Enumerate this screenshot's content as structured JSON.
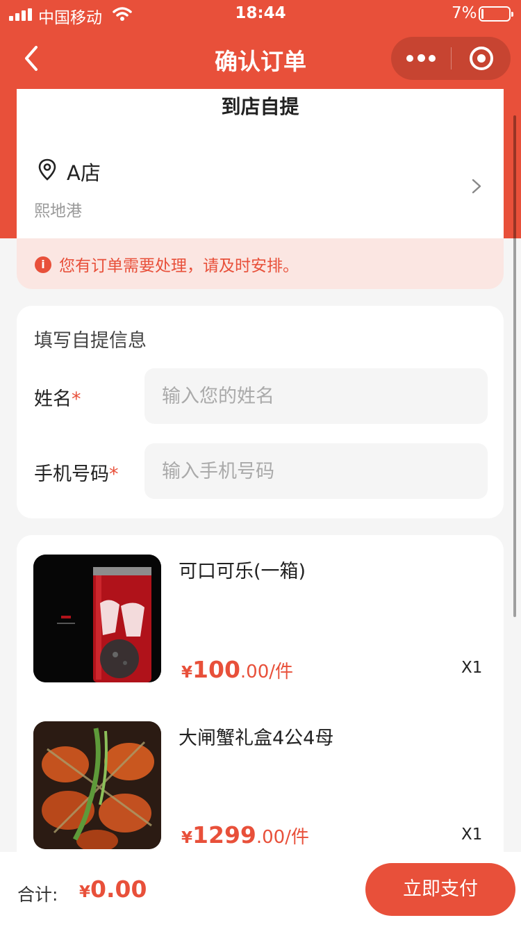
{
  "status_bar": {
    "carrier": "中国移动",
    "time": "18:44",
    "battery_percent": "7%",
    "battery_level": 0.07,
    "signal_icon": "signal-bars-icon",
    "wifi_icon": "wifi-icon"
  },
  "nav": {
    "title": "确认订单",
    "back_icon": "chevron-left-icon",
    "more_icon": "more-dots-icon",
    "close_icon": "target-close-icon"
  },
  "store": {
    "pickup_title": "到店自提",
    "name": "A店",
    "address": "熙地港",
    "pin_icon": "location-pin-icon",
    "arrow_icon": "chevron-right-icon"
  },
  "notice": {
    "text": "您有订单需要处理，请及时安排。",
    "icon": "info-icon",
    "icon_glyph": "i"
  },
  "form": {
    "title": "填写自提信息",
    "required_mark": "*",
    "name_label": "姓名",
    "name_placeholder": "输入您的姓名",
    "name_value": "",
    "phone_label": "手机号码",
    "phone_placeholder": "输入手机号码",
    "phone_value": ""
  },
  "products": [
    {
      "name": "可口可乐(一箱)",
      "currency": "¥",
      "price_int": "100",
      "price_dec": ".00/件",
      "qty": "X1"
    },
    {
      "name": "大闸蟹礼盒4公4母",
      "currency": "¥",
      "price_int": "1299",
      "price_dec": ".00/件",
      "qty": "X1"
    }
  ],
  "bottom": {
    "total_label": "合计:",
    "currency": "¥",
    "total_value": "0.00",
    "pay_label": "立即支付"
  },
  "colors": {
    "accent": "#e8503a",
    "notice_bg": "#fbe6e2",
    "page_bg": "#f5f5f5"
  }
}
